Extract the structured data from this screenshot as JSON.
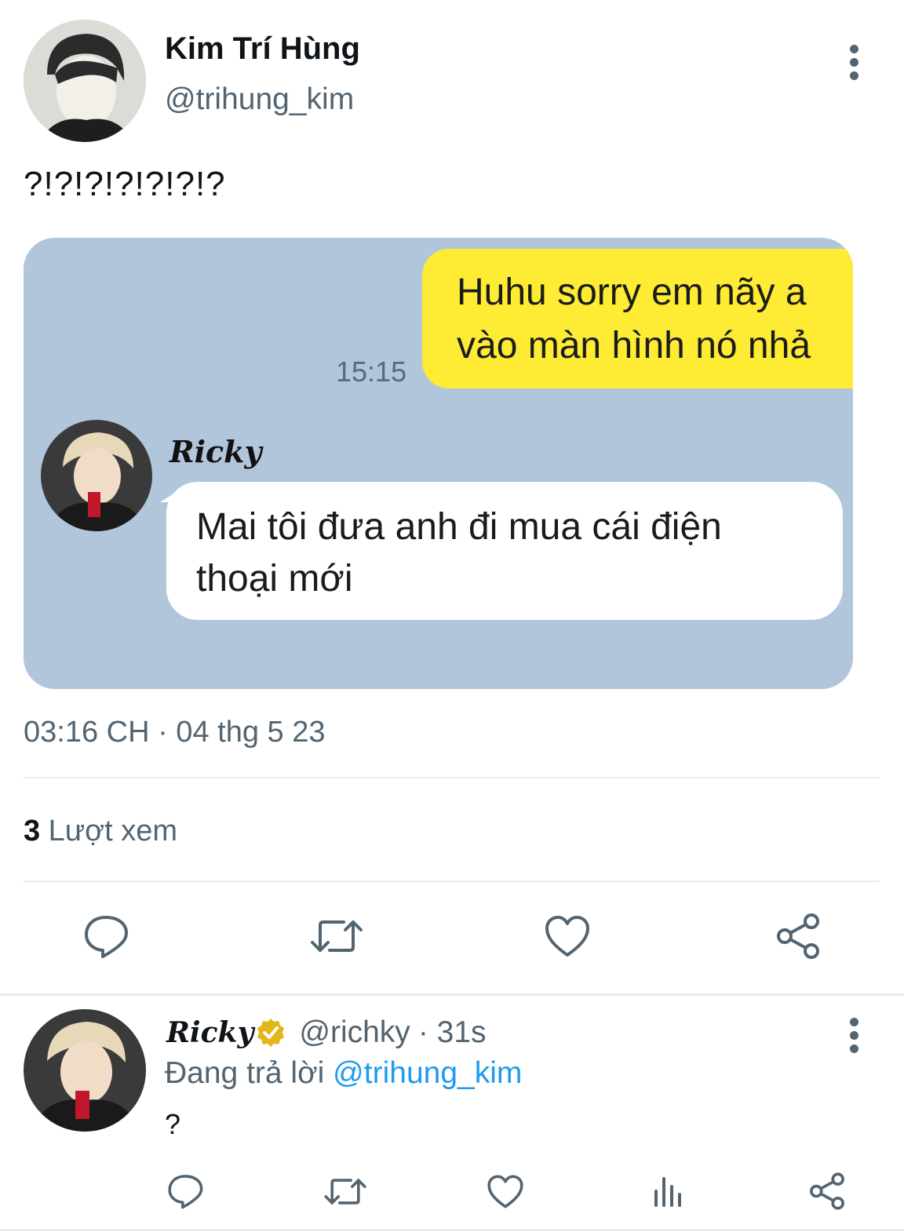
{
  "tweet": {
    "author_name": "Kim Trí Hùng",
    "author_handle": "@trihung_kim",
    "text": "?!?!?!?!?!?!?",
    "timestamp": "03:16 CH · 04 thg 5 23",
    "views_count": "3",
    "views_label": "Lượt xem"
  },
  "media": {
    "outgoing_line1": "Huhu sorry em nãy a",
    "outgoing_line2": "vào màn hình nó nhả",
    "outgoing_time": "15:15",
    "sender_name": "Ricky",
    "incoming_line1": "Mai tôi đưa anh đi mua cái điện",
    "incoming_line2": "thoại mới"
  },
  "reply": {
    "author_name": "Ricky",
    "author_handle": "@richky",
    "time": "· 31s",
    "replying_prefix": "Đang trả lời",
    "replying_to": "@trihung_kim",
    "text": "?"
  },
  "icons": {
    "reply": "comment-icon",
    "retweet": "retweet-icon",
    "like": "heart-icon",
    "share": "share-icon",
    "analytics": "analytics-icon",
    "more": "more-vertical-icon",
    "verified": "verified-badge-icon"
  },
  "colors": {
    "icon_gray": "#536471",
    "link_blue": "#1d9bf0",
    "chat_bg": "#b1c5db",
    "outgoing_bubble": "#feeb33",
    "verified_gold": "#e2b719"
  }
}
